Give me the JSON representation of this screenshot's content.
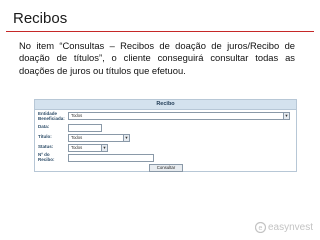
{
  "page": {
    "title": "Recibos",
    "paragraph": "No item “Consultas – Recibos de doação de juros/Recibo de doação de títulos”, o cliente conseguirá consultar todas as doações de juros ou títulos que efetuou."
  },
  "form": {
    "header": "Recibo",
    "fields": {
      "entidade_label": "Entidade Beneficiada:",
      "entidade_value": "Todos",
      "data_label": "Data:",
      "titulo_label": "Título:",
      "titulo_value": "Todos",
      "status_label": "Status:",
      "status_value": "Todos",
      "recibo_label": "Nº do Recibo:"
    },
    "submit_label": "Consultar"
  },
  "colors": {
    "accent_rule": "#c62828",
    "panel_header_bg": "#d4e2ee",
    "label_text": "#2a4a66"
  },
  "brand": {
    "name": "easynvest",
    "icon": "easynvest-logo-icon"
  }
}
